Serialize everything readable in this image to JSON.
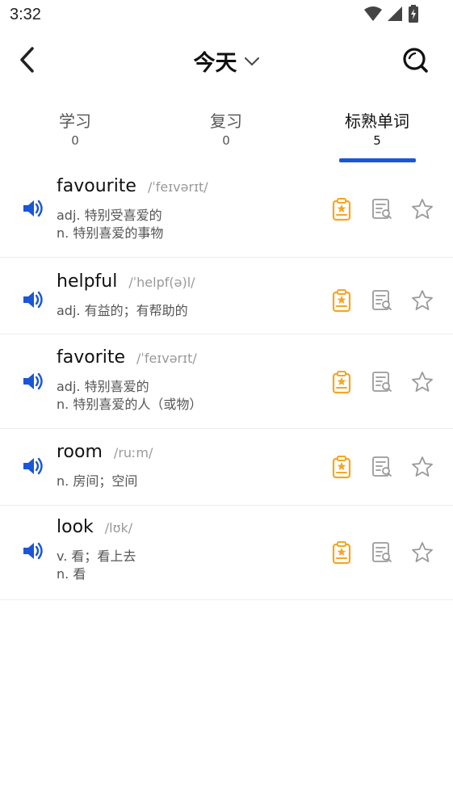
{
  "status_bar": {
    "time": "3:32"
  },
  "header": {
    "title": "今天"
  },
  "tabs": [
    {
      "label": "学习",
      "count": "0"
    },
    {
      "label": "复习",
      "count": "0"
    },
    {
      "label": "标熟单词",
      "count": "5"
    }
  ],
  "words": [
    {
      "word": "favourite",
      "phonetic": "/ˈfeɪvərɪt/",
      "defs": [
        "adj. 特别受喜爱的",
        "n. 特别喜爱的事物"
      ]
    },
    {
      "word": "helpful",
      "phonetic": "/ˈhelpf(ə)l/",
      "defs": [
        "adj. 有益的；有帮助的"
      ]
    },
    {
      "word": "favorite",
      "phonetic": "/ˈfeɪvərɪt/",
      "defs": [
        "adj. 特别喜爱的",
        "n. 特别喜爱的人（或物）"
      ]
    },
    {
      "word": "room",
      "phonetic": "/ruːm/",
      "defs": [
        "n. 房间；空间"
      ]
    },
    {
      "word": "look",
      "phonetic": "/lʊk/",
      "defs": [
        "v. 看；看上去",
        "n. 看"
      ]
    }
  ],
  "colors": {
    "accent": "#1a56d6",
    "badge_orange": "#f5a623",
    "icon_gray": "#9a9a9a"
  }
}
